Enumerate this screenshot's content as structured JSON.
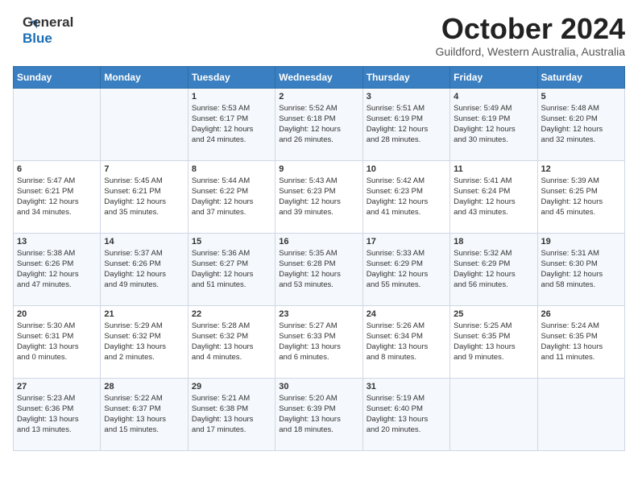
{
  "header": {
    "logo_line1": "General",
    "logo_line2": "Blue",
    "month": "October 2024",
    "location": "Guildford, Western Australia, Australia"
  },
  "weekdays": [
    "Sunday",
    "Monday",
    "Tuesday",
    "Wednesday",
    "Thursday",
    "Friday",
    "Saturday"
  ],
  "weeks": [
    [
      {
        "day": "",
        "content": ""
      },
      {
        "day": "",
        "content": ""
      },
      {
        "day": "1",
        "content": "Sunrise: 5:53 AM\nSunset: 6:17 PM\nDaylight: 12 hours\nand 24 minutes."
      },
      {
        "day": "2",
        "content": "Sunrise: 5:52 AM\nSunset: 6:18 PM\nDaylight: 12 hours\nand 26 minutes."
      },
      {
        "day": "3",
        "content": "Sunrise: 5:51 AM\nSunset: 6:19 PM\nDaylight: 12 hours\nand 28 minutes."
      },
      {
        "day": "4",
        "content": "Sunrise: 5:49 AM\nSunset: 6:19 PM\nDaylight: 12 hours\nand 30 minutes."
      },
      {
        "day": "5",
        "content": "Sunrise: 5:48 AM\nSunset: 6:20 PM\nDaylight: 12 hours\nand 32 minutes."
      }
    ],
    [
      {
        "day": "6",
        "content": "Sunrise: 5:47 AM\nSunset: 6:21 PM\nDaylight: 12 hours\nand 34 minutes."
      },
      {
        "day": "7",
        "content": "Sunrise: 5:45 AM\nSunset: 6:21 PM\nDaylight: 12 hours\nand 35 minutes."
      },
      {
        "day": "8",
        "content": "Sunrise: 5:44 AM\nSunset: 6:22 PM\nDaylight: 12 hours\nand 37 minutes."
      },
      {
        "day": "9",
        "content": "Sunrise: 5:43 AM\nSunset: 6:23 PM\nDaylight: 12 hours\nand 39 minutes."
      },
      {
        "day": "10",
        "content": "Sunrise: 5:42 AM\nSunset: 6:23 PM\nDaylight: 12 hours\nand 41 minutes."
      },
      {
        "day": "11",
        "content": "Sunrise: 5:41 AM\nSunset: 6:24 PM\nDaylight: 12 hours\nand 43 minutes."
      },
      {
        "day": "12",
        "content": "Sunrise: 5:39 AM\nSunset: 6:25 PM\nDaylight: 12 hours\nand 45 minutes."
      }
    ],
    [
      {
        "day": "13",
        "content": "Sunrise: 5:38 AM\nSunset: 6:26 PM\nDaylight: 12 hours\nand 47 minutes."
      },
      {
        "day": "14",
        "content": "Sunrise: 5:37 AM\nSunset: 6:26 PM\nDaylight: 12 hours\nand 49 minutes."
      },
      {
        "day": "15",
        "content": "Sunrise: 5:36 AM\nSunset: 6:27 PM\nDaylight: 12 hours\nand 51 minutes."
      },
      {
        "day": "16",
        "content": "Sunrise: 5:35 AM\nSunset: 6:28 PM\nDaylight: 12 hours\nand 53 minutes."
      },
      {
        "day": "17",
        "content": "Sunrise: 5:33 AM\nSunset: 6:29 PM\nDaylight: 12 hours\nand 55 minutes."
      },
      {
        "day": "18",
        "content": "Sunrise: 5:32 AM\nSunset: 6:29 PM\nDaylight: 12 hours\nand 56 minutes."
      },
      {
        "day": "19",
        "content": "Sunrise: 5:31 AM\nSunset: 6:30 PM\nDaylight: 12 hours\nand 58 minutes."
      }
    ],
    [
      {
        "day": "20",
        "content": "Sunrise: 5:30 AM\nSunset: 6:31 PM\nDaylight: 13 hours\nand 0 minutes."
      },
      {
        "day": "21",
        "content": "Sunrise: 5:29 AM\nSunset: 6:32 PM\nDaylight: 13 hours\nand 2 minutes."
      },
      {
        "day": "22",
        "content": "Sunrise: 5:28 AM\nSunset: 6:32 PM\nDaylight: 13 hours\nand 4 minutes."
      },
      {
        "day": "23",
        "content": "Sunrise: 5:27 AM\nSunset: 6:33 PM\nDaylight: 13 hours\nand 6 minutes."
      },
      {
        "day": "24",
        "content": "Sunrise: 5:26 AM\nSunset: 6:34 PM\nDaylight: 13 hours\nand 8 minutes."
      },
      {
        "day": "25",
        "content": "Sunrise: 5:25 AM\nSunset: 6:35 PM\nDaylight: 13 hours\nand 9 minutes."
      },
      {
        "day": "26",
        "content": "Sunrise: 5:24 AM\nSunset: 6:35 PM\nDaylight: 13 hours\nand 11 minutes."
      }
    ],
    [
      {
        "day": "27",
        "content": "Sunrise: 5:23 AM\nSunset: 6:36 PM\nDaylight: 13 hours\nand 13 minutes."
      },
      {
        "day": "28",
        "content": "Sunrise: 5:22 AM\nSunset: 6:37 PM\nDaylight: 13 hours\nand 15 minutes."
      },
      {
        "day": "29",
        "content": "Sunrise: 5:21 AM\nSunset: 6:38 PM\nDaylight: 13 hours\nand 17 minutes."
      },
      {
        "day": "30",
        "content": "Sunrise: 5:20 AM\nSunset: 6:39 PM\nDaylight: 13 hours\nand 18 minutes."
      },
      {
        "day": "31",
        "content": "Sunrise: 5:19 AM\nSunset: 6:40 PM\nDaylight: 13 hours\nand 20 minutes."
      },
      {
        "day": "",
        "content": ""
      },
      {
        "day": "",
        "content": ""
      }
    ]
  ]
}
